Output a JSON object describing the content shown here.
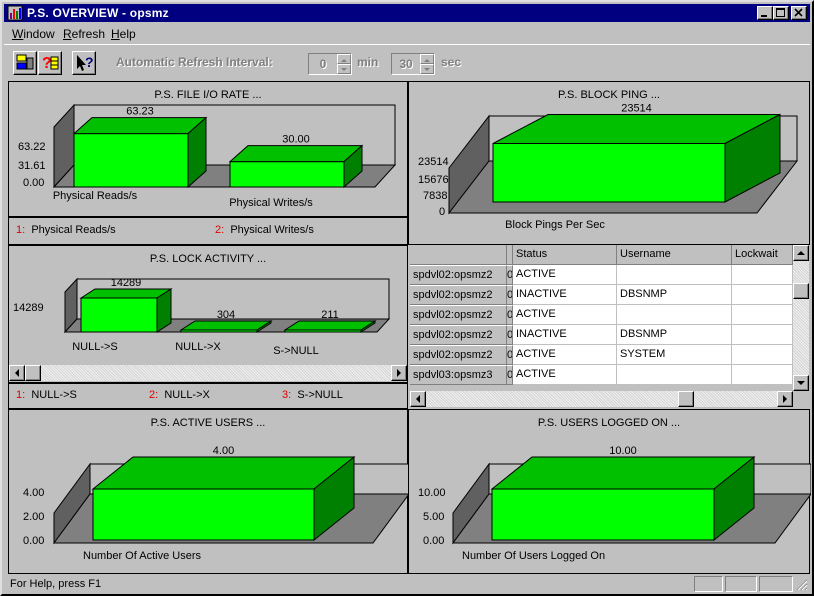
{
  "window": {
    "title": "P.S. OVERVIEW - opsmz"
  },
  "menu": {
    "items": [
      "Window",
      "Refresh",
      "Help"
    ]
  },
  "toolbar": {
    "refresh_label": "Automatic Refresh Interval:",
    "minutes_value": "0",
    "min_label": "min",
    "seconds_value": "30",
    "sec_label": "sec"
  },
  "panels": {
    "file_io": {
      "title": "P.S. FILE I/O RATE ...",
      "y_ticks": [
        "63.22",
        "31.61",
        "0.00"
      ],
      "legend": [
        {
          "num": "1:",
          "label": "Physical Reads/s"
        },
        {
          "num": "2:",
          "label": "Physical Writes/s"
        }
      ]
    },
    "block_ping": {
      "title": "P.S. BLOCK PING ...",
      "y_ticks": [
        "23514",
        "15676",
        "7838",
        "0"
      ]
    },
    "lock_activity": {
      "title": "P.S. LOCK ACTIVITY ...",
      "y_ticks": [
        "14289"
      ],
      "legend": [
        {
          "num": "1:",
          "label": "NULL->S"
        },
        {
          "num": "2:",
          "label": "NULL->X"
        },
        {
          "num": "3:",
          "label": "S->NULL"
        }
      ]
    },
    "active_users": {
      "title": "P.S. ACTIVE USERS ...",
      "y_ticks": [
        "4.00",
        "2.00",
        "0.00"
      ]
    },
    "users_logged_on": {
      "title": "P.S. USERS LOGGED ON ...",
      "y_ticks": [
        "10.00",
        "5.00",
        "0.00"
      ]
    }
  },
  "chart_data": [
    {
      "type": "bar",
      "title": "P.S. FILE I/O RATE ...",
      "categories": [
        "Physical Reads/s",
        "Physical Writes/s"
      ],
      "values": [
        63.23,
        30.0
      ],
      "value_labels": [
        "63.23",
        "30.00"
      ],
      "ylim": [
        0,
        63.22
      ]
    },
    {
      "type": "bar",
      "title": "P.S. BLOCK PING ...",
      "categories": [
        "Block Pings Per Sec"
      ],
      "values": [
        23514
      ],
      "value_labels": [
        "23514"
      ],
      "ylim": [
        0,
        23514
      ]
    },
    {
      "type": "bar",
      "title": "P.S. LOCK ACTIVITY ...",
      "categories": [
        "NULL->S",
        "NULL->X",
        "S->NULL"
      ],
      "values": [
        14289,
        304,
        211
      ],
      "value_labels": [
        "14289",
        "304",
        "211"
      ],
      "ylim": [
        0,
        14289
      ]
    },
    {
      "type": "bar",
      "title": "P.S. ACTIVE USERS ...",
      "categories": [
        "Number Of Active Users"
      ],
      "values": [
        4.0
      ],
      "value_labels": [
        "4.00"
      ],
      "ylim": [
        0,
        4.0
      ]
    },
    {
      "type": "bar",
      "title": "P.S. USERS LOGGED ON ...",
      "categories": [
        "Number Of Users Logged On"
      ],
      "values": [
        10.0
      ],
      "value_labels": [
        "10.00"
      ],
      "ylim": [
        0,
        10.0
      ]
    }
  ],
  "table": {
    "columns": [
      "",
      "Status",
      "Username",
      "Lockwait"
    ],
    "rows": [
      {
        "instance": "spdvl02:opsmz2",
        "flag": "0",
        "status": "ACTIVE",
        "username": "",
        "lockwait": ""
      },
      {
        "instance": "spdvl02:opsmz2",
        "flag": "0",
        "status": "INACTIVE",
        "username": "DBSNMP",
        "lockwait": ""
      },
      {
        "instance": "spdvl02:opsmz2",
        "flag": "0",
        "status": "ACTIVE",
        "username": "",
        "lockwait": ""
      },
      {
        "instance": "spdvl02:opsmz2",
        "flag": "0",
        "status": "INACTIVE",
        "username": "DBSNMP",
        "lockwait": ""
      },
      {
        "instance": "spdvl02:opsmz2",
        "flag": "0",
        "status": "ACTIVE",
        "username": "SYSTEM",
        "lockwait": ""
      },
      {
        "instance": "spdvl03:opsmz3",
        "flag": "0",
        "status": "ACTIVE",
        "username": "",
        "lockwait": ""
      }
    ]
  },
  "statusbar": {
    "text": "For Help, press F1"
  },
  "colors": {
    "titlebar": "#000080",
    "bar_front": "#00ff00",
    "bar_top": "#00c000",
    "bar_side": "#008000",
    "legend_num": "#e00000"
  },
  "icons": [
    "app-icon",
    "minimize-icon",
    "maximize-icon",
    "close-icon",
    "connect-icon",
    "help-db-icon",
    "context-help-icon"
  ]
}
